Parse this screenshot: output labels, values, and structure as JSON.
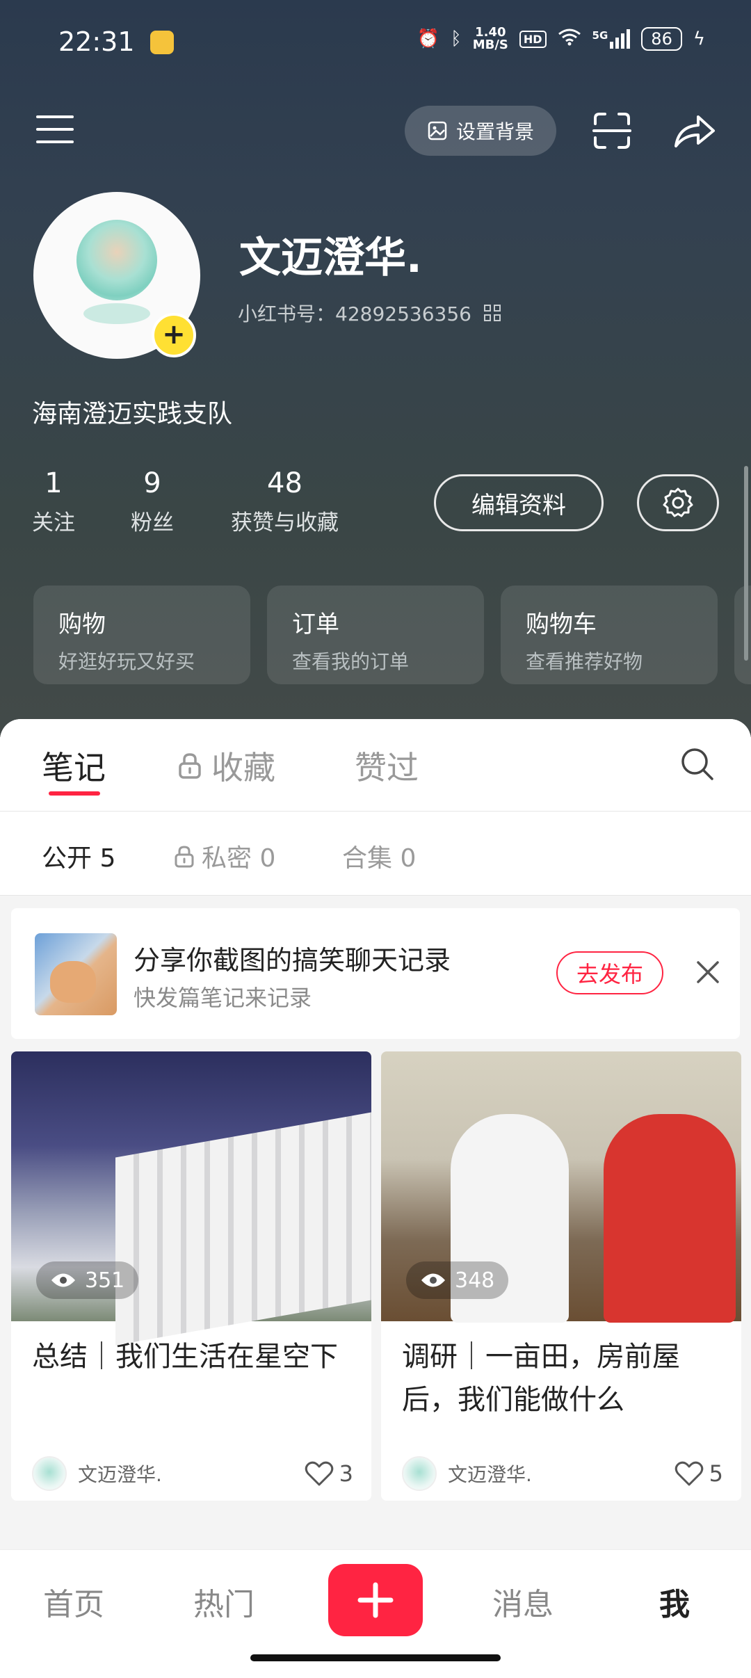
{
  "status": {
    "time": "22:31",
    "speed_value": "1.40",
    "speed_unit": "MB/S",
    "hd": "HD",
    "network": "5G",
    "battery": "86"
  },
  "topbar": {
    "set_background": "设置背景"
  },
  "profile": {
    "nickname": "文迈澄华.",
    "id_label": "小红书号：",
    "id_value": "42892536356",
    "bio": "海南澄迈实践支队",
    "stats": [
      {
        "num": "1",
        "label": "关注"
      },
      {
        "num": "9",
        "label": "粉丝"
      },
      {
        "num": "48",
        "label": "获赞与收藏"
      }
    ],
    "edit_label": "编辑资料"
  },
  "cards": [
    {
      "title": "购物",
      "subtitle": "好逛好玩又好买"
    },
    {
      "title": "订单",
      "subtitle": "查看我的订单"
    },
    {
      "title": "购物车",
      "subtitle": "查看推荐好物"
    }
  ],
  "tabs": [
    "笔记",
    "收藏",
    "赞过"
  ],
  "subtabs": [
    "公开 5",
    "私密 0",
    "合集 0"
  ],
  "promo": {
    "title": "分享你截图的搞笑聊天记录",
    "subtitle": "快发篇笔记来记录",
    "button": "去发布"
  },
  "notes": [
    {
      "views": "351",
      "title": "总结｜我们生活在星空下",
      "author": "文迈澄华.",
      "likes": "3"
    },
    {
      "views": "348",
      "title": "调研｜一亩田，房前屋后，我们能做什么",
      "author": "文迈澄华.",
      "likes": "5"
    }
  ],
  "bottom_nav": [
    "首页",
    "热门",
    "消息",
    "我"
  ],
  "colors": {
    "accent": "#ff2442",
    "header_bg": "#334150"
  }
}
